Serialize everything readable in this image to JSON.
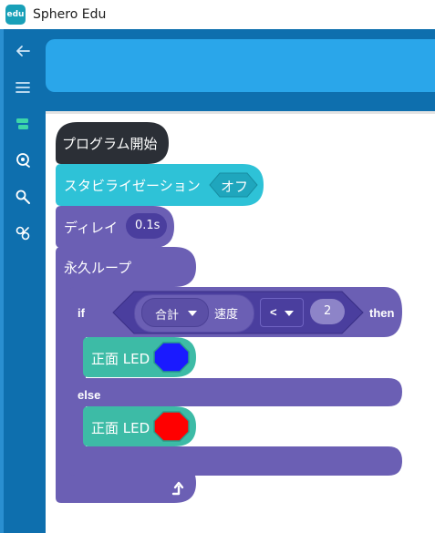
{
  "app": {
    "title": "Sphero Edu",
    "logo_text": "edu"
  },
  "sidebar": {
    "items": [
      {
        "name": "back",
        "icon": "arrow-left-icon"
      },
      {
        "name": "menu",
        "icon": "hamburger-menu-icon"
      },
      {
        "name": "blocks",
        "icon": "blocks-icon"
      },
      {
        "name": "sensors",
        "icon": "sensor-icon"
      },
      {
        "name": "tools",
        "icon": "wrench-icon"
      },
      {
        "name": "extensions",
        "icon": "puzzle-icon"
      }
    ]
  },
  "program": {
    "start": {
      "label": "プログラム開始"
    },
    "stabilization": {
      "label": "スタビライゼーション",
      "value": "オフ"
    },
    "delay": {
      "label": "ディレイ",
      "value": "0.1s"
    },
    "loop": {
      "label": "永久ループ"
    },
    "if_block": {
      "if_label": "if",
      "then_label": "then",
      "else_label": "else",
      "sensor_dropdown": "合計",
      "sensor_suffix": "速度",
      "operator": "<",
      "compare_value": "2"
    },
    "front_led_true": {
      "label": "正面 LED",
      "color": "#1a1aff"
    },
    "front_led_false": {
      "label": "正面 LED",
      "color": "#ff0000"
    },
    "loop_return_icon": "loop-return-arrow-icon"
  },
  "colors": {
    "sidebar": "#0e6fae",
    "header": "#2aa6ea",
    "start_block": "#2b2f36",
    "stabilization_block": "#2ec2d7",
    "control_blocks": "#6b5fb4",
    "operator_block": "#4a3e9e",
    "led_block": "#3dbba6"
  }
}
